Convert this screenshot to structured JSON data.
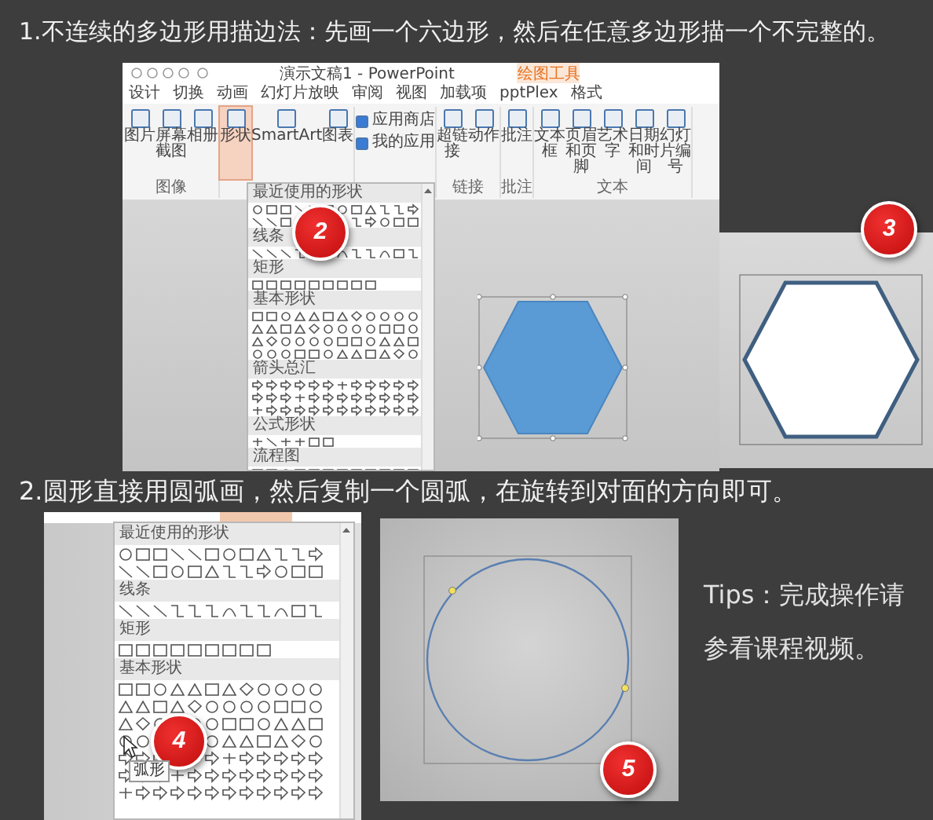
{
  "step_1": {
    "caption": "1.不连续的多边形用描边法：先画一个六边形，然后在任意多边形描一个不完整的。",
    "app_window": {
      "title": "演示文稿1 - PowerPoint",
      "context_label": "绘图工具",
      "tabs": [
        "设计",
        "切换",
        "动画",
        "幻灯片放映",
        "审阅",
        "视图",
        "加载项",
        "pptPlex",
        "格式"
      ],
      "ribbon_groups": [
        {
          "label": "图像",
          "buttons": [
            {
              "label": "图片",
              "kind": "large",
              "pressed": false
            },
            {
              "label": "屏幕截图",
              "kind": "large",
              "pressed": false
            },
            {
              "label": "相册",
              "kind": "large",
              "pressed": false
            }
          ]
        },
        {
          "buttons": [
            {
              "label": "形状",
              "kind": "large",
              "pressed": true
            },
            {
              "label": "SmartArt",
              "kind": "large",
              "pressed": false
            },
            {
              "label": "图表",
              "kind": "large",
              "pressed": false
            }
          ]
        },
        {
          "buttons": [
            {
              "label": "应用商店",
              "kind": "small",
              "pressed": false
            },
            {
              "label": "我的应用",
              "kind": "small",
              "pressed": false
            }
          ]
        },
        {
          "label": "链接",
          "buttons": [
            {
              "label": "超链接",
              "kind": "large",
              "pressed": false
            },
            {
              "label": "动作",
              "kind": "large",
              "pressed": false
            }
          ]
        },
        {
          "label": "批注",
          "buttons": [
            {
              "label": "批注",
              "kind": "large",
              "pressed": false
            }
          ]
        },
        {
          "label": "文本",
          "buttons": [
            {
              "label": "文本框",
              "kind": "large",
              "pressed": false
            },
            {
              "label": "页眉和页脚",
              "kind": "large",
              "pressed": false
            },
            {
              "label": "艺术字",
              "kind": "large",
              "pressed": false
            },
            {
              "label": "日期和时间",
              "kind": "large",
              "pressed": false
            },
            {
              "label": "幻灯片编号",
              "kind": "large",
              "pressed": false
            }
          ]
        }
      ],
      "shape_gallery": {
        "sections": [
          {
            "heading": "最近使用的形状",
            "kind": "recent"
          },
          {
            "heading": "线条",
            "kind": "lines"
          },
          {
            "heading": "矩形",
            "kind": "rectangles"
          },
          {
            "heading": "基本形状",
            "kind": "basic"
          },
          {
            "heading": "箭头总汇",
            "kind": "arrows"
          },
          {
            "heading": "公式形状",
            "kind": "equation"
          },
          {
            "heading": "流程图",
            "kind": "flowchart"
          }
        ]
      },
      "badge": "2"
    },
    "result": {
      "badge": "3"
    }
  },
  "step_2": {
    "caption": "2.圆形直接用圆弧画，然后复制一个圆弧，在旋转到对面的方向即可。",
    "gallery_window": {
      "shape_gallery": {
        "sections": [
          {
            "heading": "最近使用的形状",
            "kind": "recent"
          },
          {
            "heading": "线条",
            "kind": "lines"
          },
          {
            "heading": "矩形",
            "kind": "rectangles"
          },
          {
            "heading": "基本形状",
            "kind": "basic"
          },
          {
            "kind": "arrows"
          }
        ]
      },
      "tooltip": "弧形",
      "badge": "4"
    },
    "result": {
      "badge": "5"
    },
    "tips": "Tips：完成操作请参看课程视频。"
  }
}
